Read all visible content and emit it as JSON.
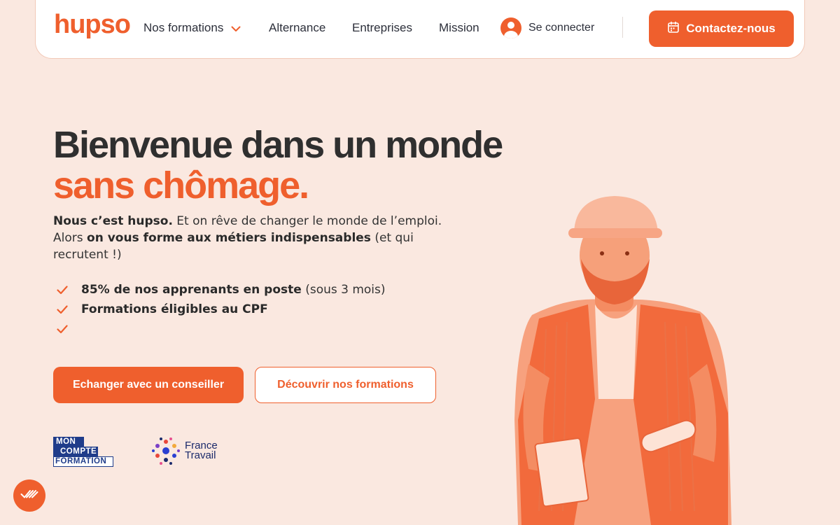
{
  "header": {
    "logo": "hupso",
    "nav": [
      {
        "label": "Nos formations"
      },
      {
        "label": "Alternance"
      },
      {
        "label": "Entreprises"
      },
      {
        "label": "Mission"
      }
    ],
    "login_label": "Se connecter",
    "contact_label": "Contactez-nous"
  },
  "hero": {
    "title_line1": "Bienvenue dans un monde",
    "title_line2": "sans chômage.",
    "intro": {
      "bold1": "Nous c’est hupso.",
      "text1": " Et on rêve de changer le monde de l’emploi. Alors ",
      "bold2": "on vous forme aux métiers indispensables",
      "text2": " (et qui recrutent !)"
    },
    "checks": [
      {
        "bold": "85% de nos apprenants en poste",
        "text": " (sous 3 mois)"
      },
      {
        "bold": "Formations éligibles au CPF",
        "text": ""
      },
      {
        "bold": "",
        "text": ""
      }
    ],
    "cta_primary": "Echanger avec un conseiller",
    "cta_secondary": "Découvrir nos formations"
  },
  "partners": {
    "mcf_line1": "MON",
    "mcf_line2": "COMPTE",
    "mcf_line3": "FORMATION",
    "ft_line1": "France",
    "ft_line2": "Travail"
  },
  "icons": {
    "nav_chevron": "chevron-down-icon",
    "login": "user-icon",
    "contact": "calendar-icon",
    "check": "check-icon",
    "consent": "checkmarks-icon"
  },
  "colors": {
    "brand": "#ef5f2d",
    "background": "#fae8e0",
    "text": "#2f2f2f",
    "partner_blue": "#1f3c8a"
  }
}
